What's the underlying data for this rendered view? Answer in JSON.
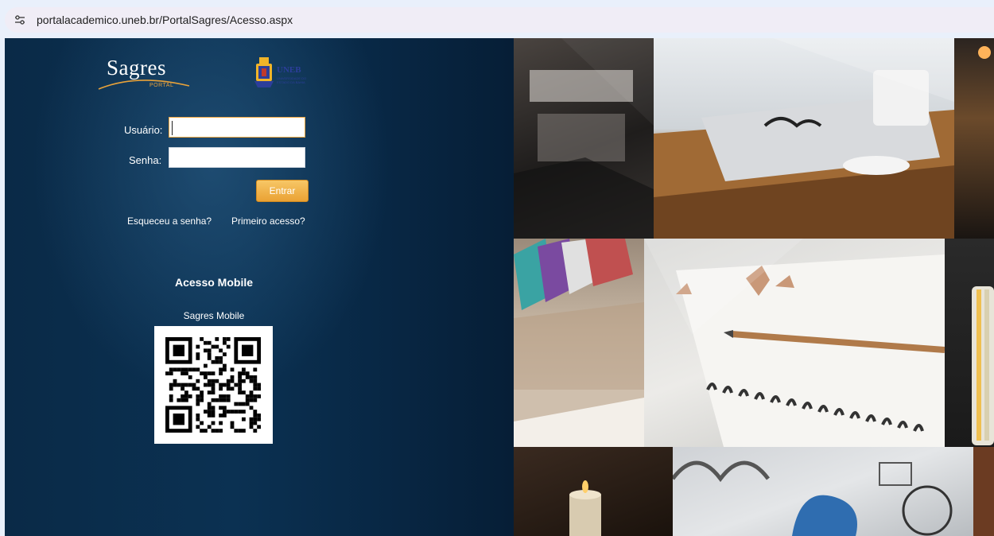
{
  "browser": {
    "url": "portalacademico.uneb.br/PortalSagres/Acesso.aspx",
    "site_info_icon": "tune-icon"
  },
  "logos": {
    "sagres": {
      "title": "Sagres",
      "subtitle": "PORTAL"
    },
    "uneb": {
      "name": "UNEB",
      "subtitle": "UNIVERSIDADE DO ESTADO DA BAHIA"
    }
  },
  "login": {
    "user_label": "Usuário:",
    "user_value": "",
    "password_label": "Senha:",
    "password_value": "",
    "submit_label": "Entrar",
    "forgot_link": "Esqueceu a senha?",
    "first_access_link": "Primeiro acesso?"
  },
  "mobile": {
    "title": "Acesso Mobile",
    "caption": "Sagres Mobile",
    "qr_icon": "qr-code-icon"
  },
  "colors": {
    "panel_dark": "#0a2a47",
    "button_orange": "#eaa234",
    "address_bar": "#e9f0fb"
  }
}
